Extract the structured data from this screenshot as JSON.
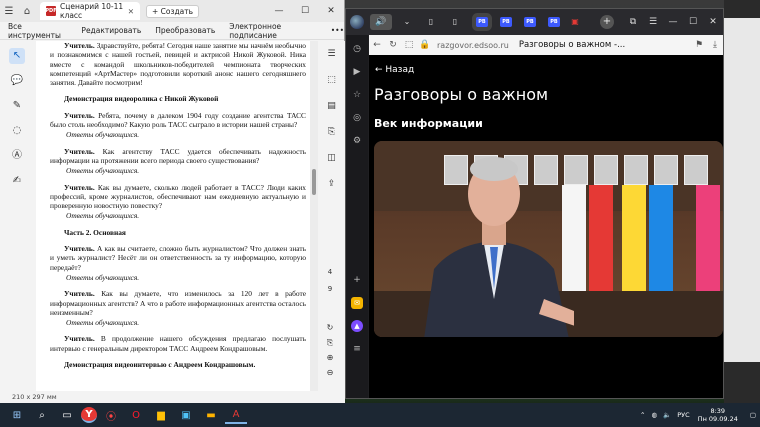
{
  "pdf": {
    "tab_title": "Сценарий 10-11 класс",
    "new_button": "Создать",
    "menu": [
      "Все инструменты",
      "Редактировать",
      "Преобразовать",
      "Электронное подписание"
    ],
    "more": "•••",
    "page_size": "210 x 297 мм",
    "page_numbers": [
      "4",
      "9"
    ],
    "lines": {
      "p1": "Учитель.",
      "p1t": "Здравствуйте, ребята! Сегодня наше занятие мы начнём необычно и познакомимся с нашей гостьей, певицей и актрисой Никой Жуковой. Ника вместе с командой школьников-победителей чемпионата творческих компетенций «АртМастер» подготовили короткий анонс нашего сегодняшнего занятия. Давайте посмотрим!",
      "h1": "Демонстрация видеоролика с Никой Жуковой",
      "p2": "Учитель.",
      "p2t": "Ребята, почему в далеком 1904 году создание агентства ТАСС было столь необходимо? Какую роль ТАСС сыграло в истории нашей страны?",
      "a1": "Ответы обучающихся.",
      "p3": "Учитель.",
      "p3t": "Как агентству ТАСС удается обеспечивать надежность информации на протяжении всего периода своего существования?",
      "a2": "Ответы обучающихся.",
      "p4": "Учитель.",
      "p4t": "Как вы думаете, сколько людей работает в ТАСС? Люди каких профессий, кроме журналистов, обеспечивают нам ежедневную актуальную и проверенную новостную повестку?",
      "a3": "Ответы обучающихся.",
      "h2": "Часть 2. Основная",
      "p5": "Учитель.",
      "p5t": "А как вы считаете, сложно быть журналистом? Что должен знать и уметь журналист? Несёт ли он ответственность за ту информацию, которую передаёт?",
      "a4": "Ответы обучающихся.",
      "p6": "Учитель.",
      "p6t": "Как вы думаете, что изменилось за 120 лет в работе информационных агентств? А что в работе информационных агентства осталось неизменным?",
      "a5": "Ответы обучающихся.",
      "p7": "Учитель.",
      "p7t": "В продолжение нашего обсуждения предлагаю послушать интервью с генеральным директором ТАСС Андреем Кондрашовым.",
      "h3": "Демонстрация видеоинтервью с Андреем Кондрашовым."
    }
  },
  "browser": {
    "url": "razgovor.edsoo.ru",
    "tab_title": "Разговоры о важном -...",
    "back_link": "← Назад",
    "heading": "Разговоры о важном",
    "subheading": "Век информации",
    "tab_badge": "PB"
  },
  "taskbar": {
    "lang": "РУС",
    "time": "8:39",
    "date": "Пн 09.09.24"
  }
}
